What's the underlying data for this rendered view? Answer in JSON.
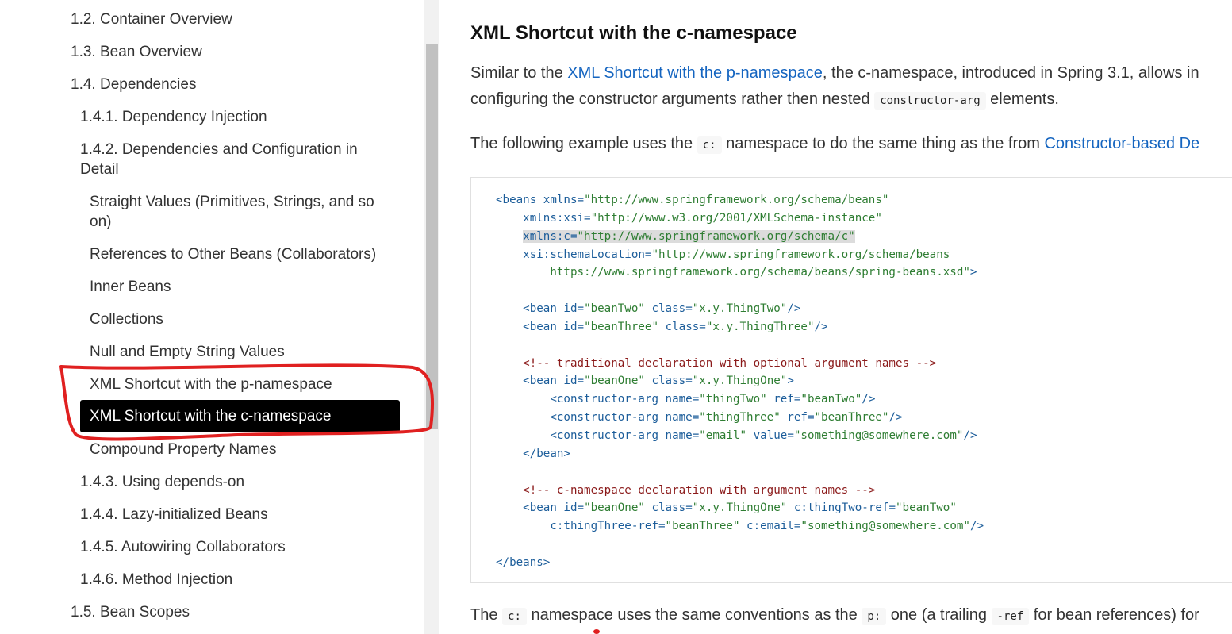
{
  "sidebar": {
    "items": [
      {
        "label": "1.2. Container Overview"
      },
      {
        "label": "1.3. Bean Overview"
      },
      {
        "label": "1.4. Dependencies"
      },
      {
        "label": "1.4.1. Dependency Injection"
      },
      {
        "label": "1.4.2. Dependencies and Configuration in Detail"
      },
      {
        "label": "Straight Values (Primitives, Strings, and so on)"
      },
      {
        "label": "References to Other Beans (Collaborators)"
      },
      {
        "label": "Inner Beans"
      },
      {
        "label": "Collections"
      },
      {
        "label": "Null and Empty String Values"
      },
      {
        "label": "XML Shortcut with the p-namespace"
      },
      {
        "label": "XML Shortcut with the c-namespace",
        "active": true
      },
      {
        "label": "Compound Property Names"
      },
      {
        "label": "1.4.3. Using depends-on"
      },
      {
        "label": "1.4.4. Lazy-initialized Beans"
      },
      {
        "label": "1.4.5. Autowiring Collaborators"
      },
      {
        "label": "1.4.6. Method Injection"
      },
      {
        "label": "1.5. Bean Scopes"
      }
    ]
  },
  "annotation": {
    "color": "#e02020"
  },
  "content": {
    "heading": "XML Shortcut with the c-namespace",
    "p1": {
      "t1": "Similar to the ",
      "link": "XML Shortcut with the p-namespace",
      "t2": ", the c-namespace, introduced in Spring 3.1, allows in",
      "t3": "configuring the constructor arguments rather then nested ",
      "code": "constructor-arg",
      "t4": " elements."
    },
    "p2": {
      "t1": "The following example uses the ",
      "code": "c:",
      "t2": " namespace to do the same thing as the from ",
      "link": "Constructor-based De"
    },
    "code": {
      "l1a": "<beans ",
      "l1b": "xmlns",
      "l1c": "=",
      "l1d": "\"http://www.springframework.org/schema/beans\"",
      "l2a": "    xmlns:xsi",
      "l2b": "=",
      "l2c": "\"http://www.w3.org/2001/XMLSchema-instance\"",
      "l3a": "xmlns:c",
      "l3b": "=",
      "l3c": "\"http://www.springframework.org/schema/c\"",
      "l4a": "    xsi:schemaLocation",
      "l4b": "=",
      "l4c": "\"http://www.springframework.org/schema/beans",
      "l5": "        https://www.springframework.org/schema/beans/spring-beans.xsd\"",
      "l5b": ">",
      "l7a": "    <bean ",
      "l7b": "id",
      "l7c": "\"beanTwo\"",
      "l7d": " class",
      "l7e": "\"x.y.ThingTwo\"",
      "l7f": "/>",
      "l8a": "    <bean ",
      "l8b": "id",
      "l8c": "\"beanThree\"",
      "l8d": " class",
      "l8e": "\"x.y.ThingThree\"",
      "l8f": "/>",
      "l10": "    <!-- traditional declaration with optional argument names -->",
      "l11a": "    <bean ",
      "l11b": "id",
      "l11c": "\"beanOne\"",
      "l11d": " class",
      "l11e": "\"x.y.ThingOne\"",
      "l11f": ">",
      "l12a": "        <constructor-arg ",
      "l12b": "name",
      "l12c": "\"thingTwo\"",
      "l12d": " ref",
      "l12e": "\"beanTwo\"",
      "l12f": "/>",
      "l13a": "        <constructor-arg ",
      "l13b": "name",
      "l13c": "\"thingThree\"",
      "l13d": " ref",
      "l13e": "\"beanThree\"",
      "l13f": "/>",
      "l14a": "        <constructor-arg ",
      "l14b": "name",
      "l14c": "\"email\"",
      "l14d": " value",
      "l14e": "\"something@somewhere.com\"",
      "l14f": "/>",
      "l15": "    </bean>",
      "l17": "    <!-- c-namespace declaration with argument names -->",
      "l18a": "    <bean ",
      "l18b": "id",
      "l18c": "\"beanOne\"",
      "l18d": " class",
      "l18e": "\"x.y.ThingOne\"",
      "l18f": " c:thingTwo-ref",
      "l18g": "\"beanTwo\"",
      "l19a": "        c:thingThree-ref",
      "l19b": "\"beanThree\"",
      "l19c": " c:email",
      "l19d": "\"something@somewhere.com\"",
      "l19e": "/>",
      "l21": "</beans>",
      "eq": "="
    },
    "p3": {
      "t1": "The ",
      "code1": "c:",
      "t2": " namespace uses the same conventions as the ",
      "code2": "p:",
      "t3": " one (a trailing ",
      "code3": "-ref",
      "t4": " for bean references) for"
    }
  }
}
